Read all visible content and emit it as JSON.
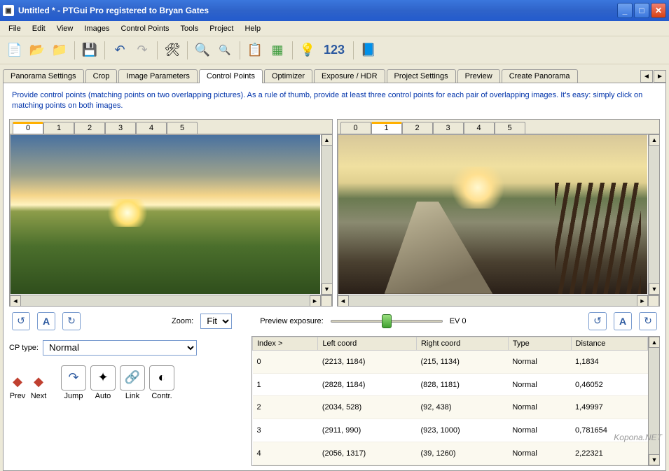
{
  "title": "Untitled * - PTGui Pro registered to Bryan Gates",
  "menus": [
    "File",
    "Edit",
    "View",
    "Images",
    "Control Points",
    "Tools",
    "Project",
    "Help"
  ],
  "toolbar_icons": [
    "new-doc",
    "open-folder",
    "add-folder",
    "save",
    "undo",
    "redo",
    "tools-hammer",
    "zoom-in",
    "zoom-out",
    "copy",
    "grid",
    "bulb",
    "123",
    "help-book"
  ],
  "main_tabs": [
    "Panorama Settings",
    "Crop",
    "Image Parameters",
    "Control Points",
    "Optimizer",
    "Exposure / HDR",
    "Project Settings",
    "Preview",
    "Create Panorama"
  ],
  "main_tab_active": "Control Points",
  "instructions": "Provide control points (matching points on two overlapping pictures). As a rule of thumb, provide at least three control points for each pair of overlapping images. It's easy: simply click on matching points on both images.",
  "left_image_tabs": [
    "0",
    "1",
    "2",
    "3",
    "4",
    "5"
  ],
  "left_image_active": "0",
  "right_image_tabs": [
    "0",
    "1",
    "2",
    "3",
    "4",
    "5"
  ],
  "right_image_active": "1",
  "zoom_label": "Zoom:",
  "zoom_value": "Fit",
  "preview_exposure_label": "Preview exposure:",
  "ev_label": "EV 0",
  "cp_type_label": "CP type:",
  "cp_type_value": "Normal",
  "tool_buttons": {
    "prev": "Prev",
    "next": "Next",
    "jump": "Jump",
    "auto": "Auto",
    "link": "Link",
    "contr": "Contr."
  },
  "table_headers": [
    "Index >",
    "Left coord",
    "Right coord",
    "Type",
    "Distance"
  ],
  "table_rows": [
    {
      "index": "0",
      "left": "(2213, 1184)",
      "right": "(215, 1134)",
      "type": "Normal",
      "dist": "1,1834"
    },
    {
      "index": "1",
      "left": "(2828, 1184)",
      "right": "(828, 1181)",
      "type": "Normal",
      "dist": "0,46052"
    },
    {
      "index": "2",
      "left": "(2034, 528)",
      "right": "(92, 438)",
      "type": "Normal",
      "dist": "1,49997"
    },
    {
      "index": "3",
      "left": "(2911, 990)",
      "right": "(923, 1000)",
      "type": "Normal",
      "dist": "0,781654"
    },
    {
      "index": "4",
      "left": "(2056, 1317)",
      "right": "(39, 1260)",
      "type": "Normal",
      "dist": "2,22321"
    }
  ],
  "watermark": "Kopona.NET"
}
